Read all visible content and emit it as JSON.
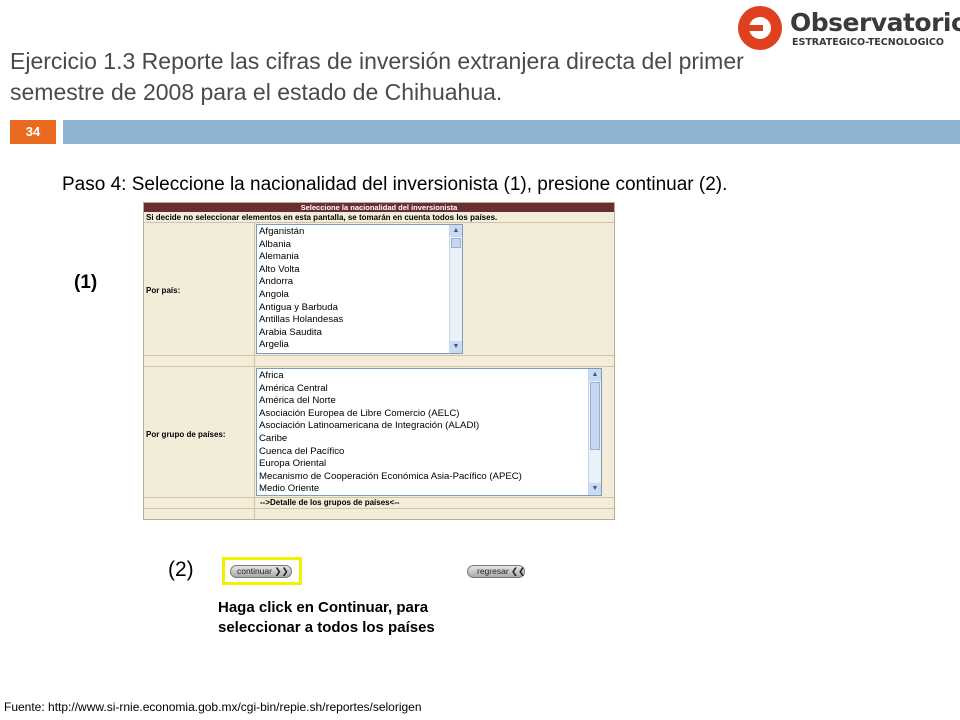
{
  "logo": {
    "name": "Observatorio",
    "subtitle": "ESTRATEGICO-TECNOLOGICO"
  },
  "slide": {
    "title_line1": "Ejercicio 1.3 Reporte las cifras de inversión extranjera directa del primer",
    "title_line2": "semestre de 2008 para el estado de Chihuahua.",
    "page_number": "34",
    "step_text": "Paso 4: Seleccione la nacionalidad  del inversionista (1), presione continuar (2).",
    "marker_1": "(1)",
    "marker_2": "(2)",
    "instruction_line1": "Haga click en Continuar, para",
    "instruction_line2": "seleccionar a todos los países",
    "source": "Fuente: http://www.si-rnie.economia.gob.mx/cgi-bin/repie.sh/reportes/selorigen"
  },
  "form": {
    "header": "Seleccione la nacionalidad del inversionista",
    "note": "Si decide no seleccionar elementos en esta pantalla, se tomarán en cuenta todos los países.",
    "pais_label": "Por país:",
    "paises": [
      "Afganistán",
      "Albania",
      "Alemania",
      "Alto Volta",
      "Andorra",
      "Angola",
      "Antigua y Barbuda",
      "Antillas Holandesas",
      "Arabia Saudita",
      "Argelia"
    ],
    "grupo_label": "Por grupo de países:",
    "grupos": [
      "Africa",
      "América Central",
      "América del Norte",
      "Asociación Europea de Libre Comercio (AELC)",
      "Asociación Latinoamericana de Integración (ALADI)",
      "Caribe",
      "Cuenca del Pacífico",
      "Europa Oriental",
      "Mecanismo de Cooperación Económica Asia-Pacífico (APEC)",
      "Medio Oriente"
    ],
    "detalle_link": "-->Detalle de los grupos de países<--"
  },
  "buttons": {
    "continuar": "continuar ❯❯",
    "regresar": "regresar ❮❮"
  },
  "colors": {
    "band": "#8eb4d3",
    "page_badge": "#e86a1f",
    "form_header": "#6a2e32",
    "form_bg": "#f3ecd9",
    "highlight": "#f1f100",
    "logo": "#e0401e"
  }
}
